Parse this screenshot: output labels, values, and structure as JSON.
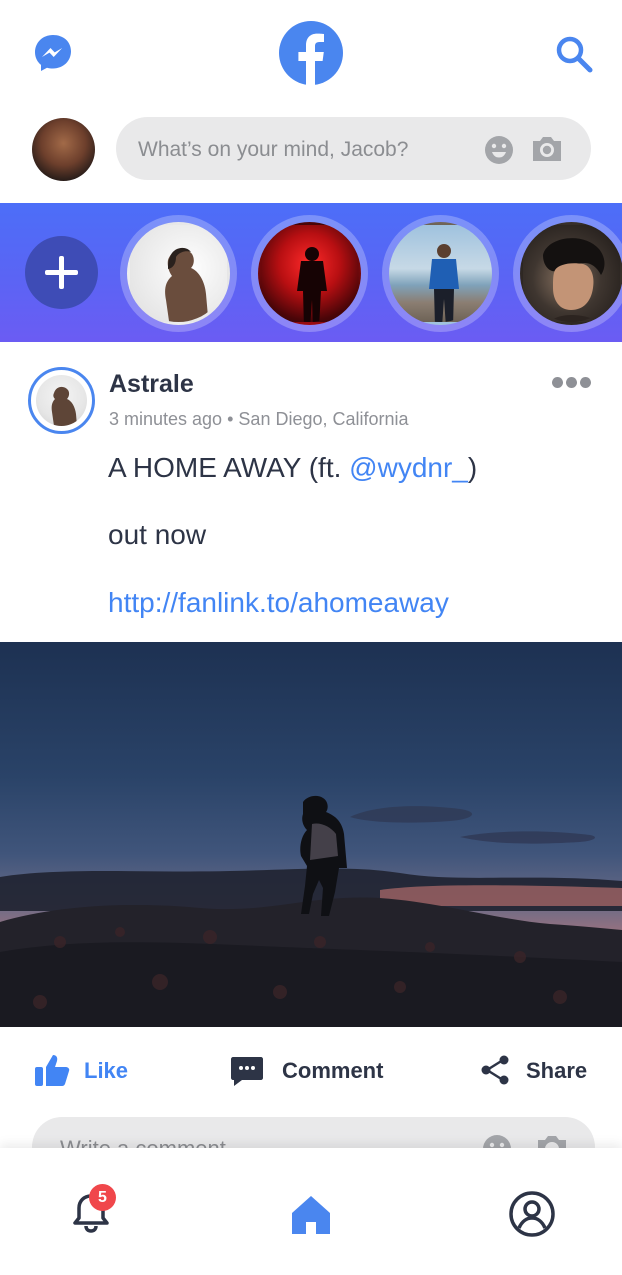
{
  "header": {
    "messenger_icon": "messenger-icon",
    "logo_icon": "facebook-logo-icon",
    "search_icon": "search-icon"
  },
  "composer": {
    "placeholder": "What’s on your mind, Jacob?",
    "emoji_icon": "smiley-icon",
    "camera_icon": "camera-icon"
  },
  "stories": {
    "add_icon": "plus-icon",
    "items": [
      "story-1",
      "story-2",
      "story-3",
      "story-4"
    ]
  },
  "post": {
    "author": "Astrale",
    "time": "3 minutes ago",
    "separator": "•",
    "location": "San Diego, California",
    "text_before_mention": "A HOME AWAY (ft. ",
    "mention": "@wydnr_",
    "text_after_mention": ")",
    "line2": "out now",
    "link": "http://fanlink.to/ahomeaway"
  },
  "actions": {
    "like": "Like",
    "comment": "Comment",
    "share": "Share"
  },
  "comment_box": {
    "placeholder": "Write a comment..."
  },
  "nav": {
    "notification_count": "5",
    "bell_icon": "bell-icon",
    "home_icon": "home-icon",
    "profile_icon": "profile-icon"
  },
  "colors": {
    "accent": "#4285f4",
    "stories_gradient_start": "#4c6ef8",
    "stories_gradient_end": "#6b5cf3",
    "badge": "#f0474b",
    "text_dark": "#2d3446"
  }
}
